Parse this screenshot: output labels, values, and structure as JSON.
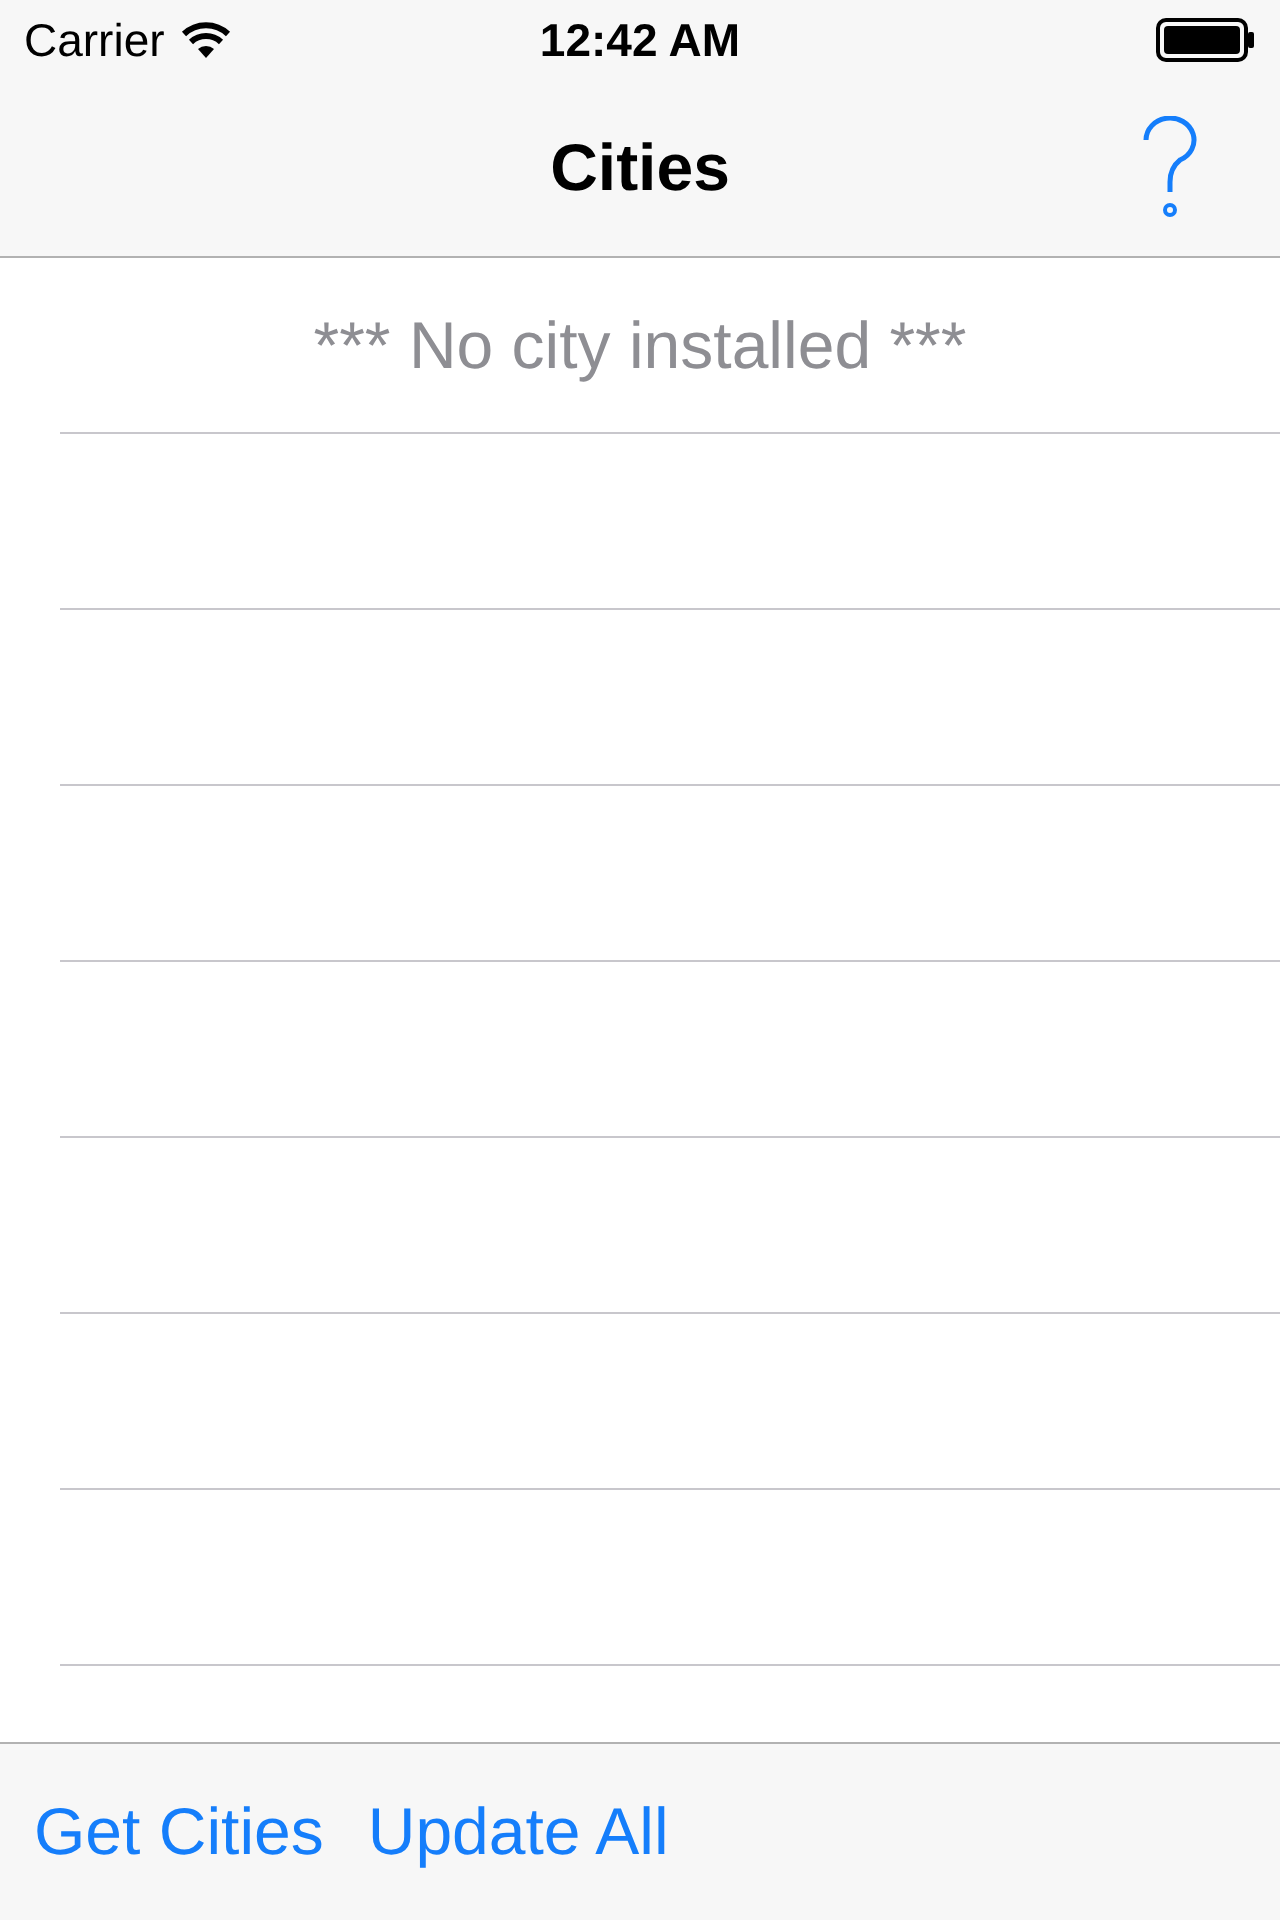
{
  "status_bar": {
    "carrier": "Carrier",
    "time": "12:42 AM"
  },
  "nav": {
    "title": "Cities"
  },
  "list": {
    "empty_message": "*** No city installed ***"
  },
  "toolbar": {
    "buttons": [
      "Get Cities",
      "Update All"
    ]
  }
}
